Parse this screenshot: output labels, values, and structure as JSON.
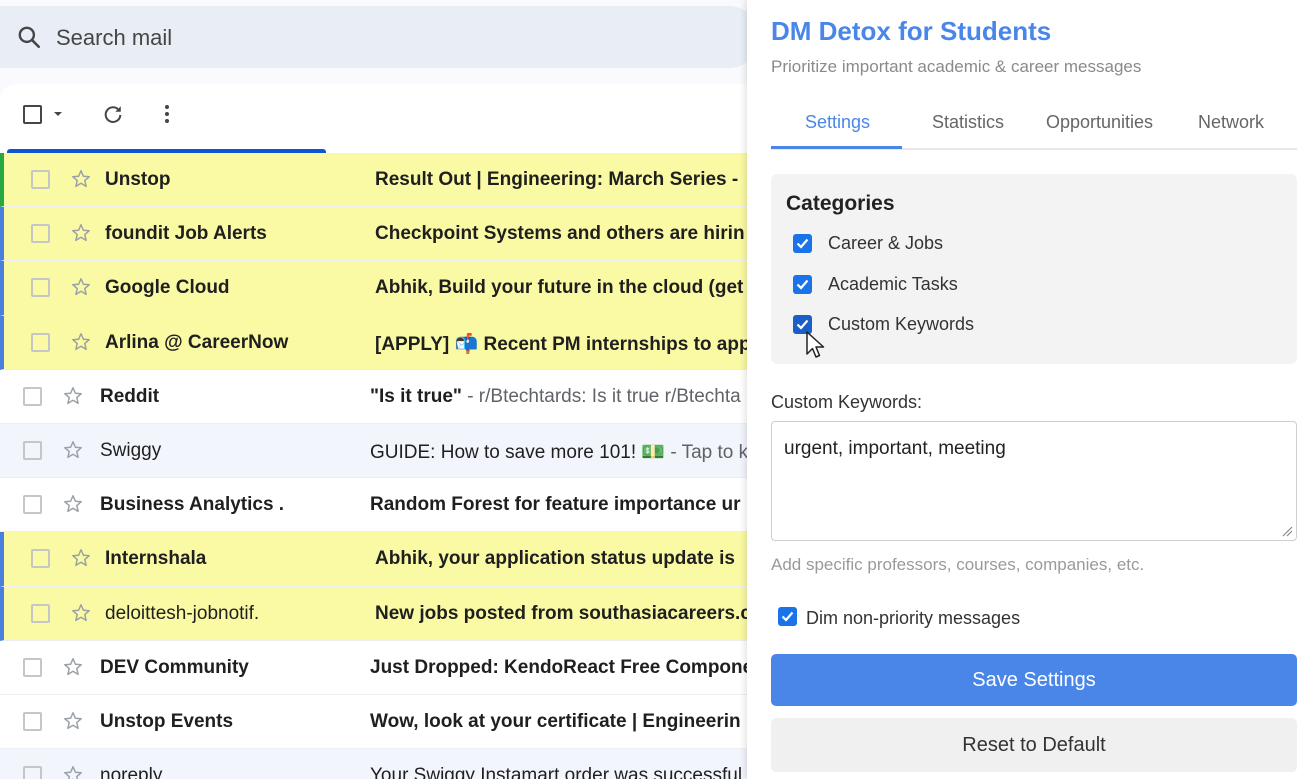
{
  "gmail": {
    "search_placeholder": "Search mail",
    "emails": [
      {
        "sender": "Unstop",
        "subject": "Result Out | Engineering: March Series -",
        "snippet": "",
        "highlighted": true
      },
      {
        "sender": "foundit Job Alerts",
        "subject": "Checkpoint Systems and others are hirin",
        "snippet": "",
        "highlighted": true
      },
      {
        "sender": "Google Cloud",
        "subject": "Abhik, Build your future in the cloud (get",
        "snippet": "",
        "highlighted": true
      },
      {
        "sender": "Arlina @ CareerNow",
        "subject": "[APPLY] 📬 Recent PM internships to app",
        "snippet": "",
        "highlighted": true
      },
      {
        "sender": "Reddit",
        "subject": "\"Is it true\"",
        "snippet": " - r/Btechtards: Is it true r/Btechta",
        "highlighted": false
      },
      {
        "sender": "Swiggy",
        "subject": "GUIDE: How to save more 101! 💵",
        "snippet": " - Tap to kr",
        "highlighted": false
      },
      {
        "sender": "Business Analytics .",
        "subject": "Random Forest for feature importance ur",
        "snippet": "",
        "highlighted": false
      },
      {
        "sender": "Internshala",
        "subject": "Abhik, your application status update is",
        "snippet": "",
        "highlighted": true
      },
      {
        "sender": "deloittesh-jobnotif.",
        "subject": "New jobs posted from southasiacareers.c",
        "snippet": "",
        "highlighted": true
      },
      {
        "sender": "DEV Community",
        "subject": "Just Dropped: KendoReact Free Compone",
        "snippet": "",
        "highlighted": false
      },
      {
        "sender": "Unstop Events",
        "subject": "Wow, look at your certificate | Engineerin",
        "snippet": "",
        "highlighted": false
      },
      {
        "sender": "noreply",
        "subject": "Your Swiggy Instamart order was successful",
        "snippet": "",
        "highlighted": false
      }
    ]
  },
  "panel": {
    "title": "DM Detox for Students",
    "subtitle": "Prioritize important academic & career messages",
    "tabs": [
      "Settings",
      "Statistics",
      "Opportunities",
      "Network"
    ],
    "active_tab": "Settings",
    "categories_title": "Categories",
    "categories": [
      {
        "label": "Career & Jobs",
        "checked": true
      },
      {
        "label": "Academic Tasks",
        "checked": true
      },
      {
        "label": "Custom Keywords",
        "checked": true
      }
    ],
    "custom_keywords_label": "Custom Keywords:",
    "custom_keywords_value": "urgent, important, meeting",
    "custom_keywords_hint": "Add specific professors, courses, companies, etc.",
    "dim_label": "Dim non-priority messages",
    "dim_checked": true,
    "save_label": "Save Settings",
    "reset_label": "Reset to Default"
  },
  "colors": {
    "accent": "#4a86e8",
    "highlight_row": "#fafaa4",
    "checkbox": "#1a73e8"
  }
}
